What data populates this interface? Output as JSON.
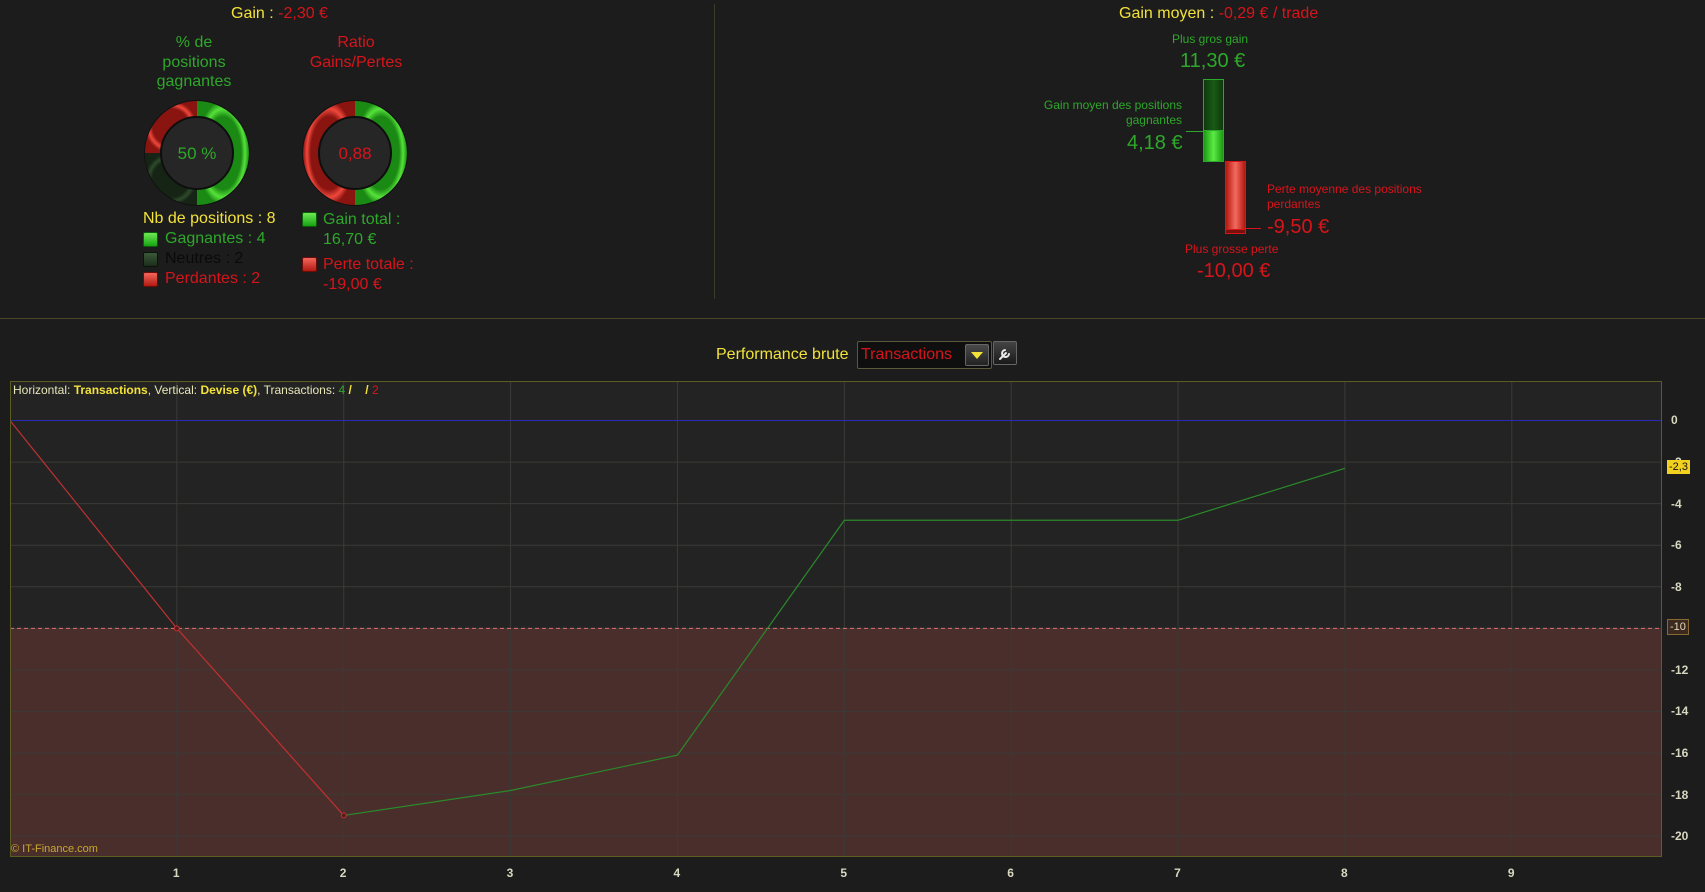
{
  "summary": {
    "gain_label": "Gain :",
    "gain_value": "-2,30 €",
    "pct_winning_label_lines": [
      "% de",
      "positions",
      "gagnantes"
    ],
    "pct_winning_value": "50 %",
    "pct_winning_fraction": 0.5,
    "ratio_label_lines": [
      "Ratio",
      "Gains/Pertes"
    ],
    "ratio_value": "0,88",
    "positions_count_label": "Nb de positions : 8",
    "winning_label": "Gagnantes : 4",
    "neutral_label": "Neutres : 2",
    "losing_label": "Perdantes : 2",
    "gain_total_lines": [
      "Gain total :",
      "16,70 €"
    ],
    "perte_totale_lines": [
      "Perte totale :",
      "-19,00 €"
    ]
  },
  "average": {
    "label": "Gain moyen :",
    "value": "-0,29 € / trade",
    "biggest_gain_label": "Plus gros gain",
    "biggest_gain_value": "11,30 €",
    "avg_winning_lines": [
      "Gain moyen des positions",
      "gagnantes"
    ],
    "avg_winning_value": "4,18 €",
    "avg_losing_lines": [
      "Perte moyenne des positions",
      "perdantes"
    ],
    "avg_losing_value": "-9,50 €",
    "biggest_loss_label": "Plus grosse perte",
    "biggest_loss_value": "-10,00 €"
  },
  "controls": {
    "performance_label": "Performance brute",
    "mode_value": "Transactions"
  },
  "chart_info": {
    "horizontal_label": "Horizontal:",
    "horizontal_value": "Transactions",
    "vertical_label": ", Vertical:",
    "vertical_value": "Devise (€)",
    "transactions_label": ", Transactions:",
    "tx_win": "4",
    "tx_sep1": " / ",
    "tx_neutral": "2",
    "tx_sep2": " / ",
    "tx_loss": "2"
  },
  "copyright": "© IT-Finance.com",
  "chart_data": {
    "type": "line",
    "x": [
      0,
      1,
      2,
      3,
      4,
      5,
      6,
      7,
      8
    ],
    "y": [
      0,
      -10,
      -19,
      -17.8,
      -16.1,
      -4.8,
      -4.8,
      -4.8,
      -2.3
    ],
    "xlim": [
      0,
      9.9
    ],
    "ylim": [
      -21,
      1.9
    ],
    "x_ticks": [
      1,
      2,
      3,
      4,
      5,
      6,
      7,
      8,
      9
    ],
    "y_ticks": [
      0,
      -2,
      -4,
      -6,
      -8,
      -10,
      -12,
      -14,
      -16,
      -18,
      -20
    ],
    "y_tick_labels": [
      "0",
      "-2",
      "-4",
      "-6",
      "-8",
      "-10",
      "-12",
      "-14",
      "-16",
      "-18",
      "-20"
    ],
    "baseline": 0,
    "max_drawdown_level": -10,
    "last_value_label": "-2,3",
    "drawdown_label": "-10",
    "colors": {
      "loss": "#c03030",
      "gain": "#2a8a2a",
      "baseline": "#2a2ab8",
      "zone": "#4a2e2c"
    },
    "grid": true
  }
}
